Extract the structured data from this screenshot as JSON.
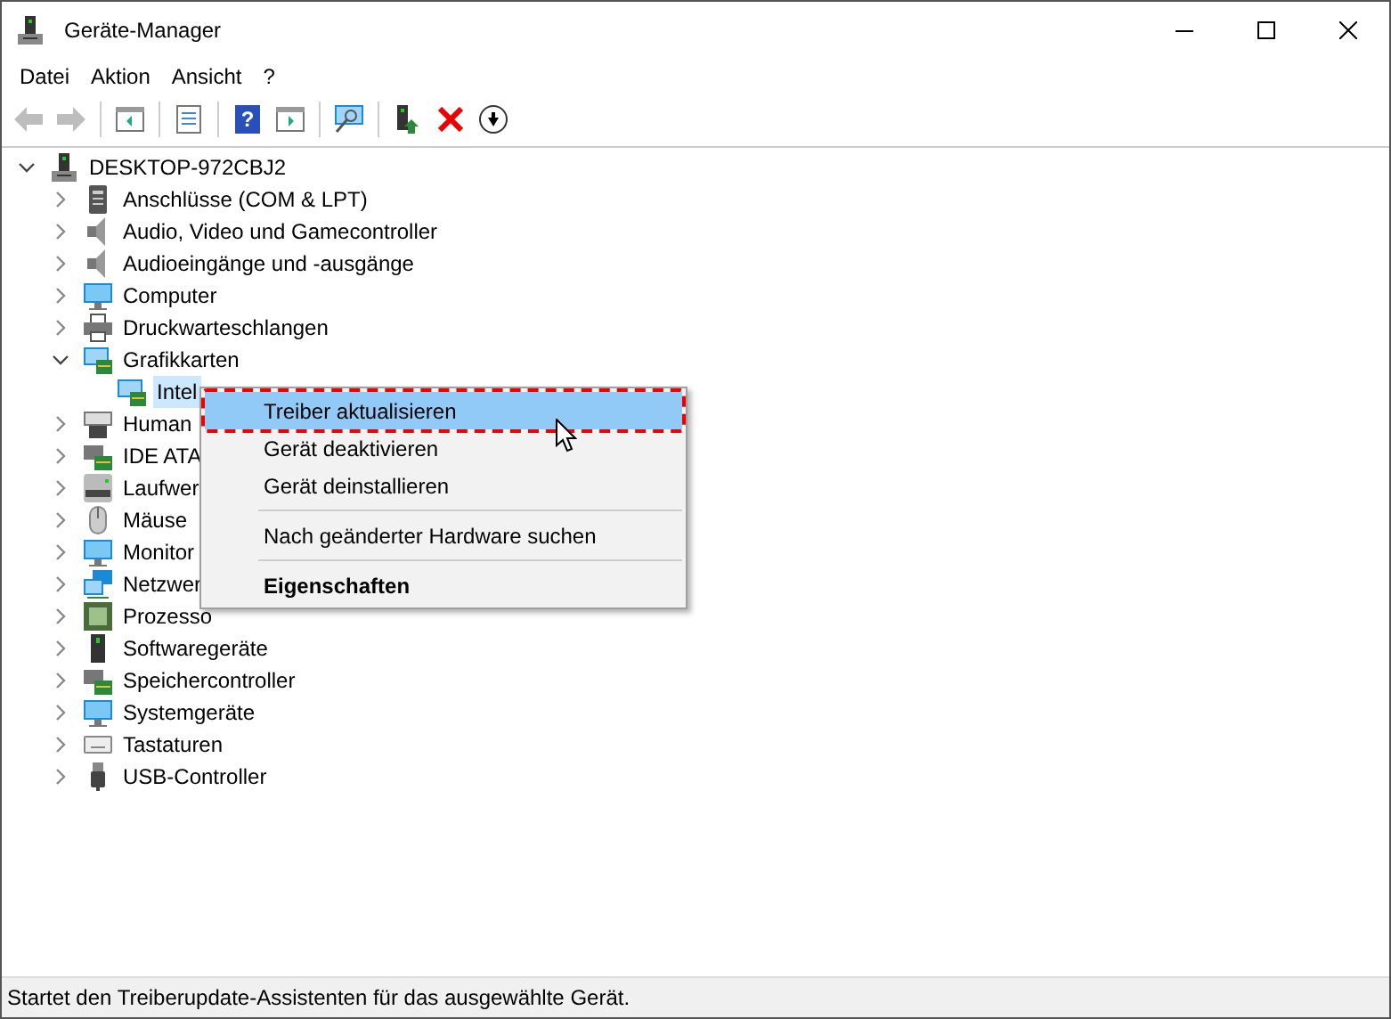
{
  "window": {
    "title": "Geräte-Manager"
  },
  "menubar": [
    "Datei",
    "Aktion",
    "Ansicht",
    "?"
  ],
  "toolbar": [
    {
      "kind": "back",
      "disabled": true
    },
    {
      "kind": "forward",
      "disabled": true
    },
    {
      "kind": "sep"
    },
    {
      "kind": "panel-left",
      "disabled": false
    },
    {
      "kind": "sep"
    },
    {
      "kind": "properties",
      "disabled": false
    },
    {
      "kind": "sep"
    },
    {
      "kind": "help",
      "label": "?",
      "disabled": false
    },
    {
      "kind": "panel-right",
      "disabled": false
    },
    {
      "kind": "sep"
    },
    {
      "kind": "scan",
      "disabled": false
    },
    {
      "kind": "sep"
    },
    {
      "kind": "update",
      "disabled": false
    },
    {
      "kind": "remove",
      "disabled": false
    },
    {
      "kind": "download",
      "disabled": false
    }
  ],
  "tree": {
    "label": "DESKTOP-972CBJ2",
    "expanded": true,
    "children": [
      {
        "label": "Anschlüsse (COM & LPT)",
        "expanded": false
      },
      {
        "label": "Audio, Video und Gamecontroller",
        "expanded": false
      },
      {
        "label": "Audioeingänge und -ausgänge",
        "expanded": false
      },
      {
        "label": "Computer",
        "expanded": false
      },
      {
        "label": "Druckwarteschlangen",
        "expanded": false
      },
      {
        "label": "Grafikkarten",
        "expanded": true,
        "children": [
          {
            "label": "Intel",
            "selected": true
          }
        ]
      },
      {
        "label": "Human",
        "expanded": false
      },
      {
        "label": "IDE ATA",
        "expanded": false
      },
      {
        "label": "Laufwer",
        "expanded": false
      },
      {
        "label": "Mäuse",
        "expanded": false
      },
      {
        "label": "Monitor",
        "expanded": false
      },
      {
        "label": "Netzwer",
        "expanded": false
      },
      {
        "label": "Prozesso",
        "expanded": false
      },
      {
        "label": "Softwaregeräte",
        "expanded": false
      },
      {
        "label": "Speichercontroller",
        "expanded": false
      },
      {
        "label": "Systemgeräte",
        "expanded": false
      },
      {
        "label": "Tastaturen",
        "expanded": false
      },
      {
        "label": "USB-Controller",
        "expanded": false
      }
    ]
  },
  "context_menu": [
    {
      "kind": "item",
      "label": "Treiber aktualisieren",
      "selected": true,
      "default": false
    },
    {
      "kind": "item",
      "label": "Gerät deaktivieren",
      "selected": false,
      "default": false
    },
    {
      "kind": "item",
      "label": "Gerät deinstallieren",
      "selected": false,
      "default": false
    },
    {
      "kind": "separator"
    },
    {
      "kind": "item",
      "label": "Nach geänderter Hardware suchen",
      "selected": false,
      "default": false
    },
    {
      "kind": "separator"
    },
    {
      "kind": "item",
      "label": "Eigenschaften",
      "selected": false,
      "default": true
    }
  ],
  "status_bar": "Startet den Treiberupdate-Assistenten für das ausgewählte Gerät."
}
